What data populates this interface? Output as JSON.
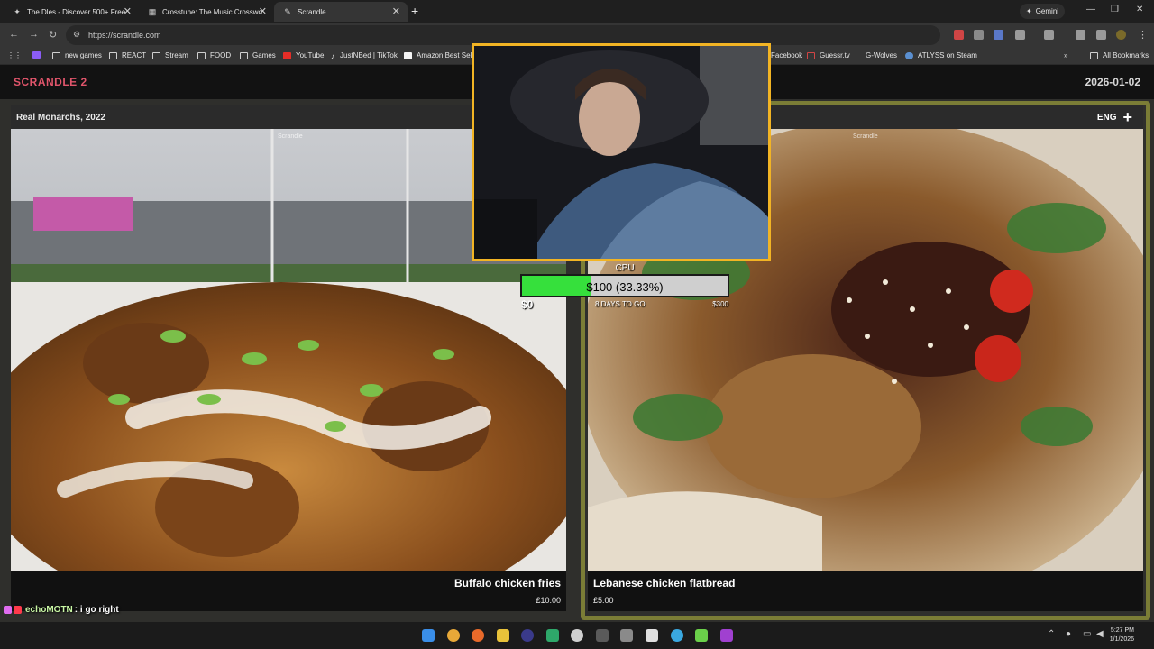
{
  "browser": {
    "tabs": [
      {
        "title": "The Dles - Discover 500+ Free",
        "active": false
      },
      {
        "title": "Crosstune: The Music Crosswo",
        "active": false
      },
      {
        "title": "Scrandle",
        "active": true
      }
    ],
    "gemini_label": "Gemini",
    "url": "https://scrandle.com",
    "bookmarks": [
      "new games",
      "REACT",
      "Stream",
      "FOOD",
      "Games",
      "YouTube",
      "JustNBed | TikTok",
      "Amazon Best Selle",
      "Facebook",
      "Guessr.tv",
      "G-Wolves",
      "ATLYSS on Steam"
    ],
    "all_bookmarks": "All Bookmarks"
  },
  "site": {
    "brand": "SCRANDLE 2",
    "date": "2026-01-02",
    "lang": "ENG"
  },
  "left_card": {
    "header": "Real Monarchs, 2022",
    "watermark": "Scrandle",
    "name": "Buffalo chicken fries",
    "price": "£10.00"
  },
  "right_card": {
    "watermark": "Scrandle",
    "name": "Lebanese chicken flatbread",
    "price": "£5.00"
  },
  "cpu": {
    "label": "CPU",
    "value_text": "$100 (33.33%)",
    "fraction": 0.3333,
    "min": "$0",
    "days": "8 DAYS TO GO",
    "max": "$300"
  },
  "chat": {
    "user": "echoMOTN",
    "message": ": i go right"
  },
  "clock": {
    "time": "5:27 PM",
    "date": "1/1/2026"
  },
  "colors": {
    "brand": "#e0556b",
    "webcam_border": "#f2b424",
    "selected_frame": "#7b7d36",
    "progress": "#36e03c"
  }
}
